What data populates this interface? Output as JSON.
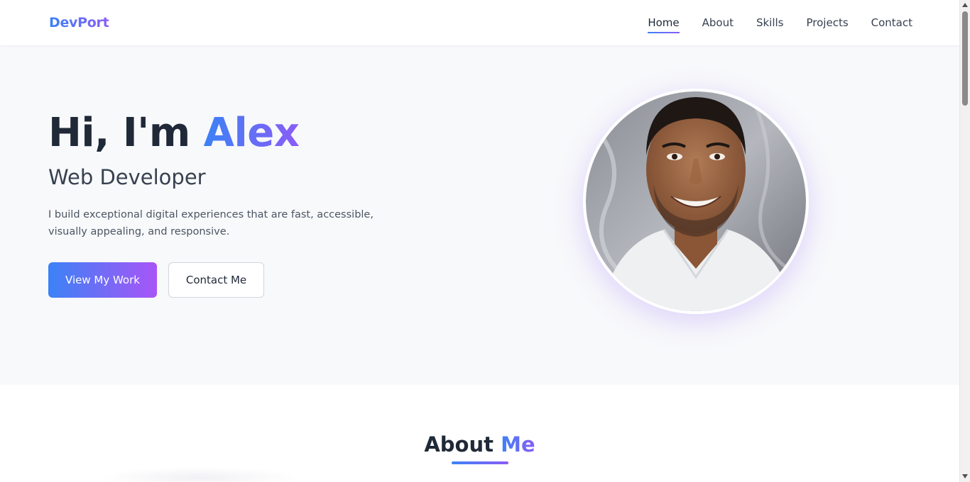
{
  "brand": {
    "logo": "DevPort",
    "accent_start": "#3b82f6",
    "accent_end": "#8b5cf6"
  },
  "nav": {
    "items": [
      {
        "label": "Home",
        "active": true
      },
      {
        "label": "About",
        "active": false
      },
      {
        "label": "Skills",
        "active": false
      },
      {
        "label": "Projects",
        "active": false
      },
      {
        "label": "Contact",
        "active": false
      }
    ]
  },
  "hero": {
    "greeting": "Hi, I'm ",
    "name": "Alex",
    "subtitle": "Web Developer",
    "description": "I build exceptional digital experiences that are fast, accessible, visually appealing, and responsive.",
    "primary_button": "View My Work",
    "secondary_button": "Contact Me",
    "photo_icon": "profile-photo"
  },
  "about": {
    "title_main": "About ",
    "title_highlight": "Me"
  }
}
